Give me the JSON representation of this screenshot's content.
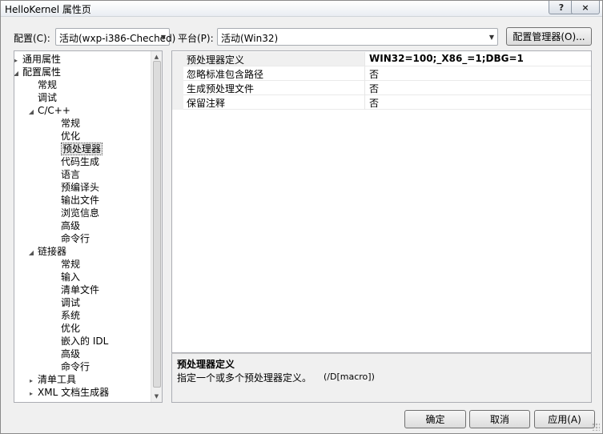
{
  "window": {
    "title": "HelloKernel 属性页",
    "help_glyph": "?",
    "close_glyph": "×"
  },
  "toolbar": {
    "config_label": "配置(C):",
    "config_value": "活动(wxp-i386-Cheched)",
    "platform_label": "平台(P):",
    "platform_value": "活动(Win32)",
    "config_manager_label": "配置管理器(O)..."
  },
  "tree": {
    "nodes": [
      {
        "label": "通用属性",
        "toggle": "▸"
      },
      {
        "label": "配置属性",
        "toggle": "◢"
      },
      {
        "label": "常规",
        "toggle": ""
      },
      {
        "label": "调试",
        "toggle": ""
      },
      {
        "label": "C/C++",
        "toggle": "◢"
      },
      {
        "label": "常规",
        "toggle": ""
      },
      {
        "label": "优化",
        "toggle": ""
      },
      {
        "label": "预处理器",
        "toggle": "",
        "selected": true
      },
      {
        "label": "代码生成",
        "toggle": ""
      },
      {
        "label": "语言",
        "toggle": ""
      },
      {
        "label": "预编译头",
        "toggle": ""
      },
      {
        "label": "输出文件",
        "toggle": ""
      },
      {
        "label": "浏览信息",
        "toggle": ""
      },
      {
        "label": "高级",
        "toggle": ""
      },
      {
        "label": "命令行",
        "toggle": ""
      },
      {
        "label": "链接器",
        "toggle": "◢"
      },
      {
        "label": "常规",
        "toggle": ""
      },
      {
        "label": "输入",
        "toggle": ""
      },
      {
        "label": "清单文件",
        "toggle": ""
      },
      {
        "label": "调试",
        "toggle": ""
      },
      {
        "label": "系统",
        "toggle": ""
      },
      {
        "label": "优化",
        "toggle": ""
      },
      {
        "label": "嵌入的 IDL",
        "toggle": ""
      },
      {
        "label": "高级",
        "toggle": ""
      },
      {
        "label": "命令行",
        "toggle": ""
      },
      {
        "label": "清单工具",
        "toggle": "▸"
      },
      {
        "label": "XML 文档生成器",
        "toggle": "▸"
      }
    ]
  },
  "properties": [
    {
      "name": "预处理器定义",
      "value": "WIN32=100;_X86_=1;DBG=1",
      "selected": true
    },
    {
      "name": "忽略标准包含路径",
      "value": "否"
    },
    {
      "name": "生成预处理文件",
      "value": "否"
    },
    {
      "name": "保留注释",
      "value": "否"
    }
  ],
  "description": {
    "title": "预处理器定义",
    "text": "指定一个或多个预处理器定义。",
    "switch": "(/D[macro])"
  },
  "buttons": {
    "ok": "确定",
    "cancel": "取消",
    "apply": "应用(A)"
  }
}
